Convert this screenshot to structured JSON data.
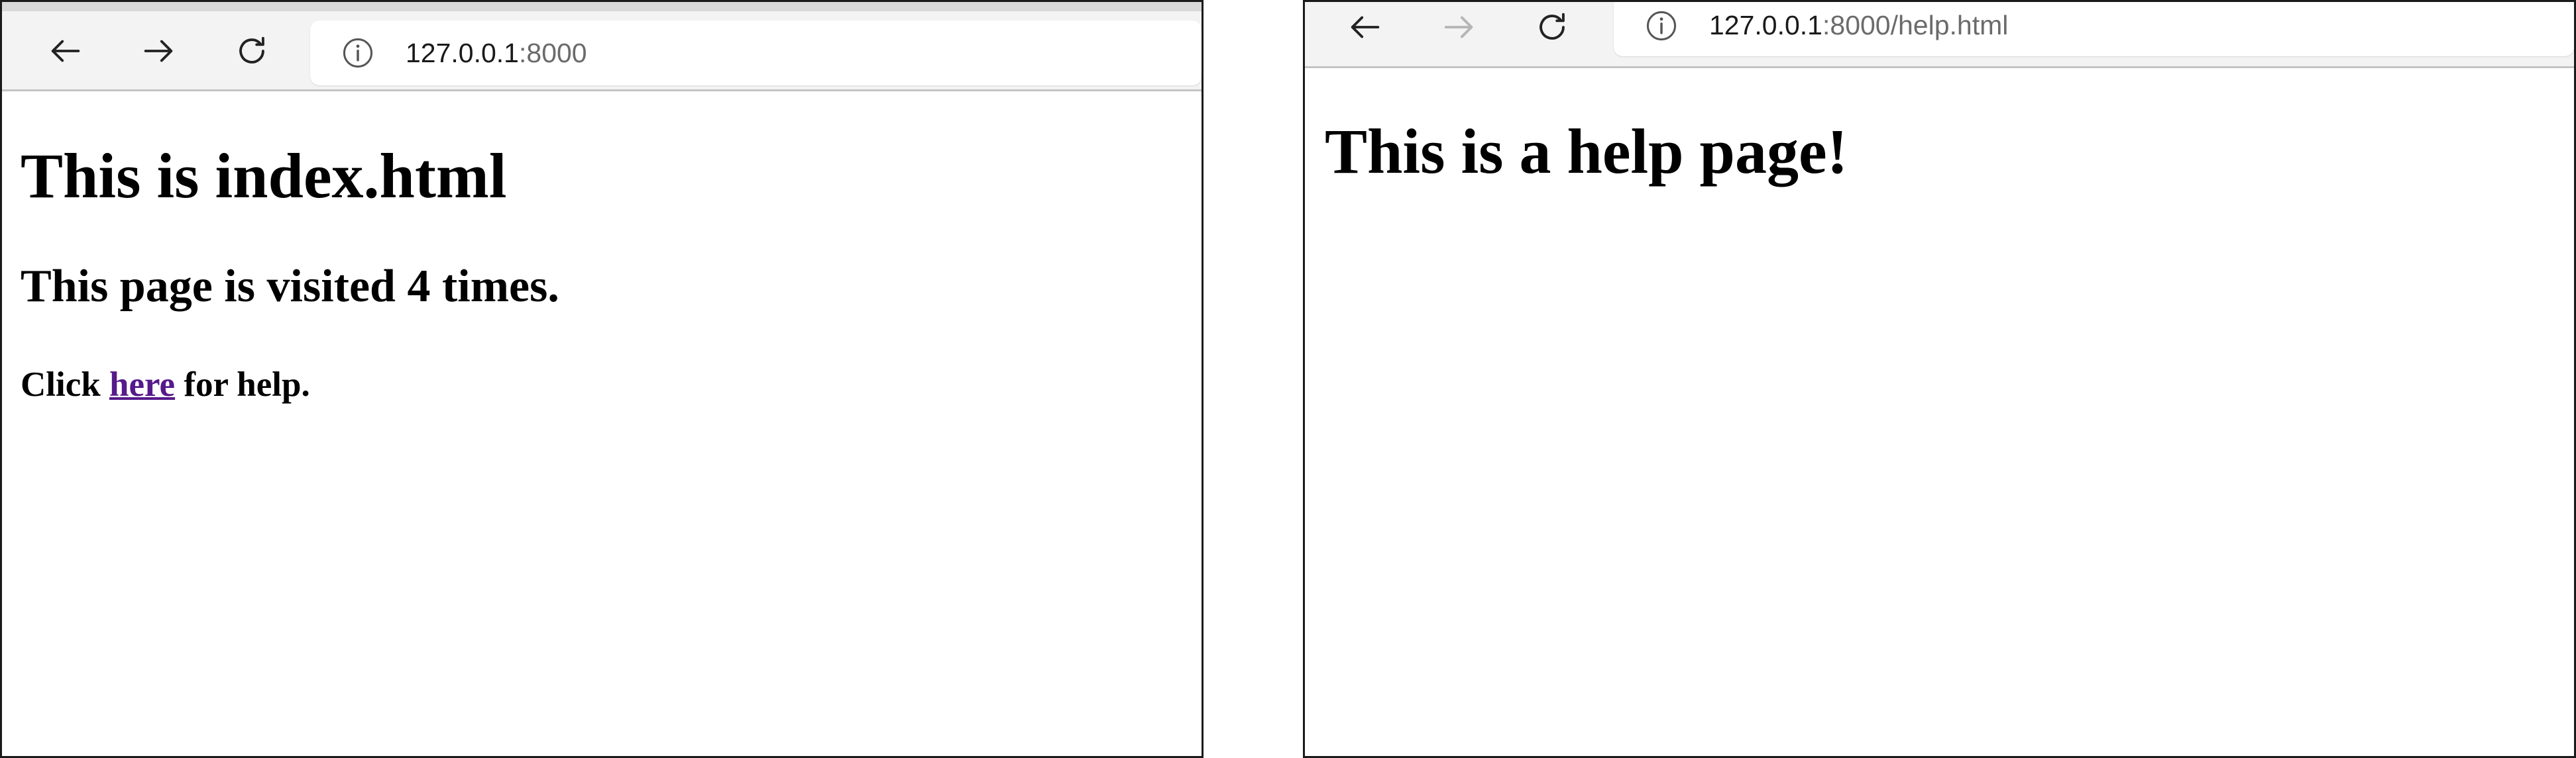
{
  "windows": [
    {
      "url_host": "127.0.0.1",
      "url_rest": ":8000",
      "page": {
        "heading": "This is index.html",
        "visits": "This page is visited 4 times.",
        "help_prefix": "Click ",
        "help_link": "here",
        "help_suffix": " for help."
      },
      "forward_enabled": true
    },
    {
      "url_host": "127.0.0.1",
      "url_rest": ":8000/help.html",
      "page": {
        "heading": "This is a help page!"
      },
      "forward_enabled": false
    }
  ],
  "icons": {
    "back": "arrow-left-icon",
    "forward": "arrow-right-icon",
    "reload": "reload-icon",
    "site_info": "info-circle-icon"
  },
  "colors": {
    "visited_link": "#551a8b",
    "toolbar": "#f3f3f3",
    "disabled_icon": "#b5b5b5"
  }
}
